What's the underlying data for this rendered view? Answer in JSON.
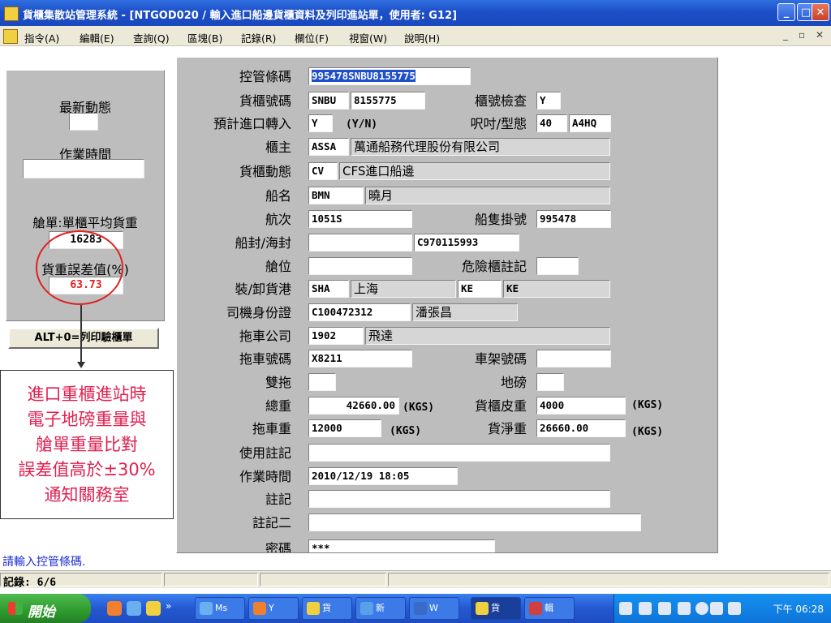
{
  "window": {
    "title": "貨櫃集散站管理系統 - [NTGOD020 / 輸入進口船邊貨櫃資料及列印進站單，使用者: G12]"
  },
  "menu": [
    "指令(A)",
    "編輯(E)",
    "查詢(Q)",
    "區塊(B)",
    "記錄(R)",
    "欄位(F)",
    "視窗(W)",
    "說明(H)"
  ],
  "left_panel": {
    "latest_status_label": "最新動態",
    "latest_status_value": "",
    "work_time_label": "作業時間",
    "work_time_value": "",
    "avg_weight_label": "艙單:單櫃平均貨重",
    "avg_weight_value": "16283",
    "error_label": "貨重誤差值(%)",
    "error_value": "63.73",
    "print_button": "ALT+0=列印驗櫃單"
  },
  "annotation": {
    "lines": [
      "進口重櫃進站時",
      "電子地磅重量與",
      "艙單重量比對",
      "誤差值高於±30%",
      "通知關務室"
    ]
  },
  "form": {
    "control_code_label": "控管條碼",
    "control_code": "995478SNBU8155775",
    "container_no_label": "貨櫃號碼",
    "container_prefix": "SNBU",
    "container_no": "8155775",
    "check_label": "櫃號檢查",
    "check_value": "Y",
    "transfer_label": "預計進口轉入",
    "transfer_value": "Y",
    "transfer_hint": "(Y/N)",
    "size_type_label": "呎吋/型態",
    "size_value": "40",
    "type_value": "A4HQ",
    "owner_label": "櫃主",
    "owner_code": "ASSA",
    "owner_name": "萬通船務代理股份有限公司",
    "movement_label": "貨櫃動態",
    "movement_code": "CV",
    "movement_desc": "CFS進口船邊",
    "vessel_label": "船名",
    "vessel_code": "BMN",
    "vessel_name": "曉月",
    "voyage_label": "航次",
    "voyage_value": "1051S",
    "call_sign_label": "船隻掛號",
    "call_sign_value": "995478",
    "seal_label": "船封/海封",
    "seal_ship": "",
    "seal_customs": "C970115993",
    "slot_label": "艙位",
    "slot_value": "",
    "dg_label": "危險櫃註記",
    "dg_value": "",
    "port_label": "裝/卸貨港",
    "port_load_code": "SHA",
    "port_load_name": "上海",
    "port_disch_code": "KE",
    "port_disch_name": "KE",
    "driver_id_label": "司機身份證",
    "driver_id": "C100472312",
    "driver_name": "潘張昌",
    "trucking_label": "拖車公司",
    "trucking_code": "1902",
    "trucking_name": "飛達",
    "truck_no_label": "拖車號碼",
    "truck_no": "X8211",
    "chassis_label": "車架號碼",
    "chassis_value": "",
    "double_label": "雙拖",
    "double_value": "",
    "scale_label": "地磅",
    "scale_value": "",
    "gross_label": "總重",
    "gross_value": "42660.00",
    "unit": "(KGS)",
    "tare_label": "貨櫃皮重",
    "tare_value": "4000",
    "truck_weight_label": "拖車重",
    "truck_weight_value": "12000",
    "net_label": "貨淨重",
    "net_value": "26660.00",
    "usage_label": "使用註記",
    "usage_value": "",
    "op_time_label": "作業時間",
    "op_time_value": "2010/12/19 18:05",
    "remark_label": "註記",
    "remark_value": "",
    "remark2_label": "註記二",
    "remark2_value": "",
    "password_label": "密碼",
    "password_value": "***"
  },
  "status": {
    "hint": "請輸入控管條碼.",
    "record": "記錄: 6/6"
  },
  "taskbar": {
    "start": "開始",
    "buttons": [
      "Ms",
      "Y",
      "貨",
      "新",
      "W",
      "貨",
      "輯"
    ],
    "clock": "下午 06:28"
  }
}
